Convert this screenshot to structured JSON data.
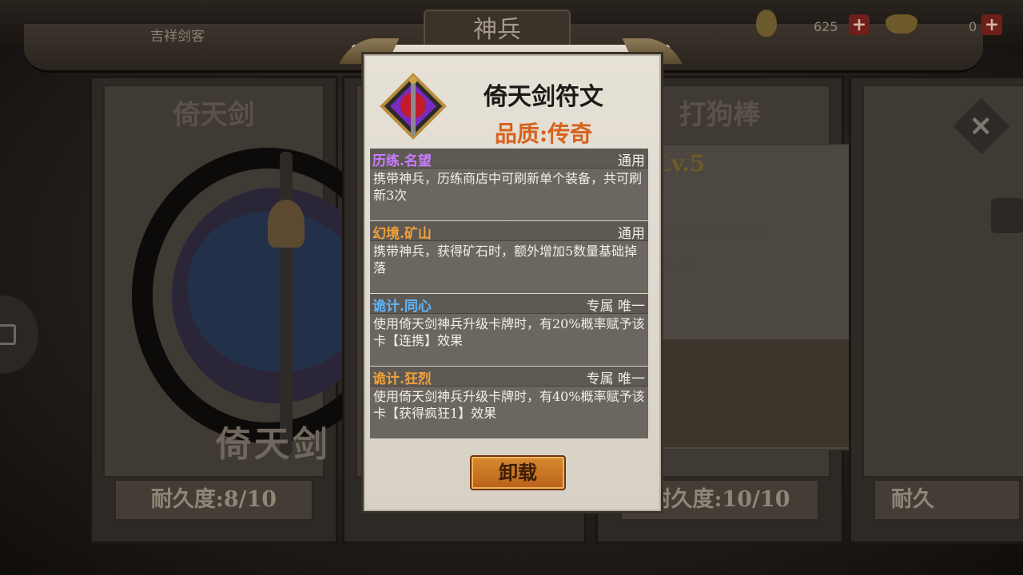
{
  "header": {
    "player_name": "吉祥剑客",
    "tab_title": "神兵",
    "resources": [
      {
        "icon": "gold-coin-icon",
        "amount": "625"
      },
      {
        "icon": "gold-ingot-icon",
        "amount": "0"
      }
    ],
    "plus_label": "+"
  },
  "cards": [
    {
      "title": "倚天剑",
      "weapon_name": "倚天剑",
      "durability": "耐久度:8/10"
    },
    {
      "title": "打狗棒",
      "level": "Lv.5",
      "line1": "牌(6场战斗冷却)",
      "line2": "复1点",
      "durability": "耐久度:10/10"
    },
    {
      "durability": "耐久"
    }
  ],
  "modal": {
    "title": "倚天剑符文",
    "quality": "品质:传奇",
    "effects": [
      {
        "name": "历练.名望",
        "tag": "通用",
        "desc": "携带神兵，历练商店中可刷新单个装备，共可刷新3次",
        "name_color": "#c77dff"
      },
      {
        "name": "幻境.矿山",
        "tag": "通用",
        "desc": "携带神兵，获得矿石时，额外增加5数量基础掉落",
        "name_color": "#f0a23a"
      },
      {
        "name": "诡计.同心",
        "tag": "专属 唯一",
        "desc": "使用倚天剑神兵升级卡牌时，有20%概率赋予该卡【连携】效果",
        "name_color": "#5db8ff"
      },
      {
        "name": "诡计.狂烈",
        "tag": "专属 唯一",
        "desc": "使用倚天剑神兵升级卡牌时，有40%概率赋予该卡【获得疯狂1】效果",
        "name_color": "#f0a23a"
      }
    ],
    "unequip_label": "卸载"
  },
  "colors": {
    "quality_legend": "#d6621f",
    "button_orange": "#c8731f"
  }
}
